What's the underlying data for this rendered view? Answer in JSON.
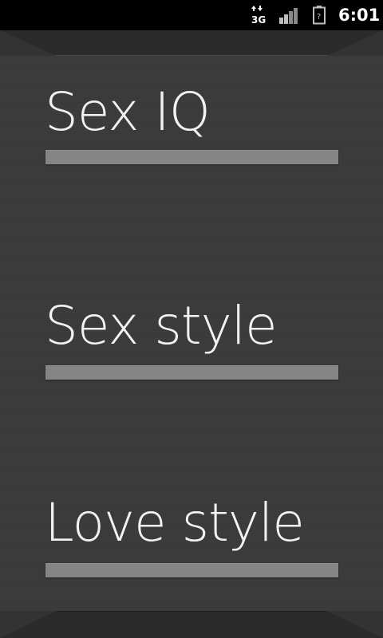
{
  "status_bar": {
    "network_type": "3G",
    "battery_state": "?",
    "time": "6:01"
  },
  "menu": {
    "items": [
      {
        "label": "Sex IQ"
      },
      {
        "label": "Sex style"
      },
      {
        "label": "Love style"
      }
    ]
  },
  "colors": {
    "background": "#3b3b3b",
    "bar": "#858585",
    "text": "#f2f2f2",
    "status_bar": "#000000"
  },
  "icons": [
    "data-transfer-3g-icon",
    "signal-strength-icon",
    "battery-unknown-icon"
  ]
}
